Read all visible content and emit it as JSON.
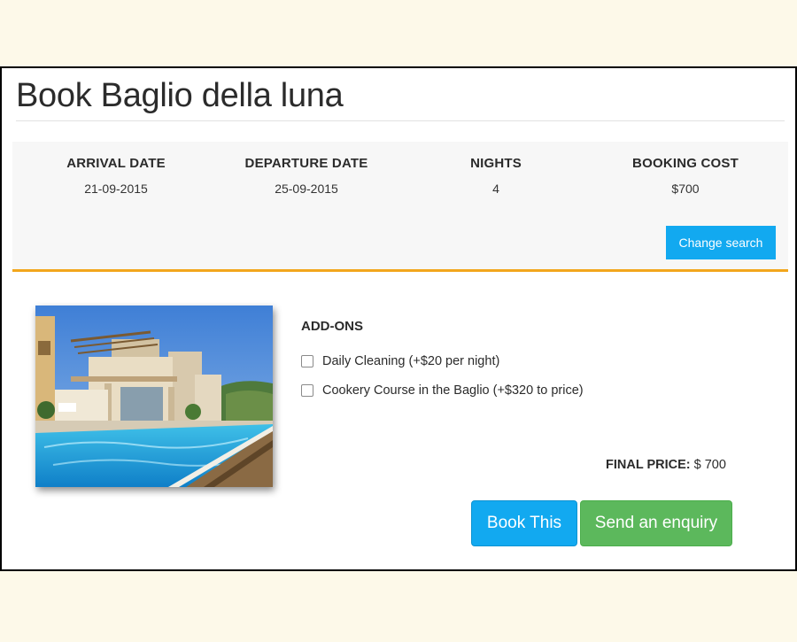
{
  "page": {
    "title": "Book Baglio della luna"
  },
  "summary": {
    "arrival": {
      "label": "ARRIVAL DATE",
      "value": "21-09-2015"
    },
    "departure": {
      "label": "DEPARTURE DATE",
      "value": "25-09-2015"
    },
    "nights": {
      "label": "NIGHTS",
      "value": "4"
    },
    "cost": {
      "label": "BOOKING COST",
      "value": "$700"
    },
    "change_search_label": "Change search"
  },
  "addons": {
    "title": "ADD-ONS",
    "items": [
      {
        "label": "Daily Cleaning (+$20 per night)",
        "checked": false
      },
      {
        "label": "Cookery Course in the Baglio (+$320 to price)",
        "checked": false
      }
    ]
  },
  "final_price": {
    "label": "FINAL PRICE:",
    "value": "$ 700"
  },
  "actions": {
    "book_label": "Book This",
    "enquiry_label": "Send an enquiry"
  },
  "colors": {
    "accent_blue": "#12a9f0",
    "accent_green": "#5cb85c",
    "divider_orange": "#f2a61c"
  }
}
